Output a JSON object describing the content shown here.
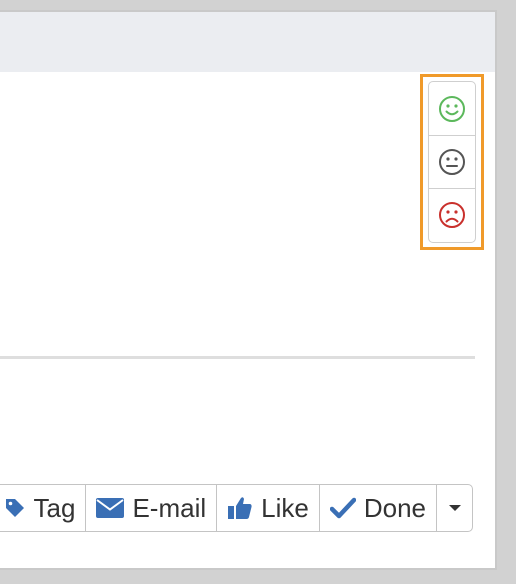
{
  "colors": {
    "accent_highlight": "#f09a2a",
    "positive": "#5cb85c",
    "neutral": "#555555",
    "negative": "#c9302c",
    "toolbar_icon": "#3a6fb5",
    "header_bg": "#ebedf1"
  },
  "feedback": {
    "items": [
      {
        "icon": "smile-icon",
        "sentiment": "positive"
      },
      {
        "icon": "neutral-face-icon",
        "sentiment": "neutral"
      },
      {
        "icon": "frown-icon",
        "sentiment": "negative"
      }
    ]
  },
  "toolbar": {
    "tag_label": "Tag",
    "email_label": "E-mail",
    "like_label": "Like",
    "done_label": "Done",
    "icons": [
      "tag-icon",
      "envelope-icon",
      "thumbs-up-icon",
      "check-icon",
      "caret-down-icon"
    ]
  }
}
